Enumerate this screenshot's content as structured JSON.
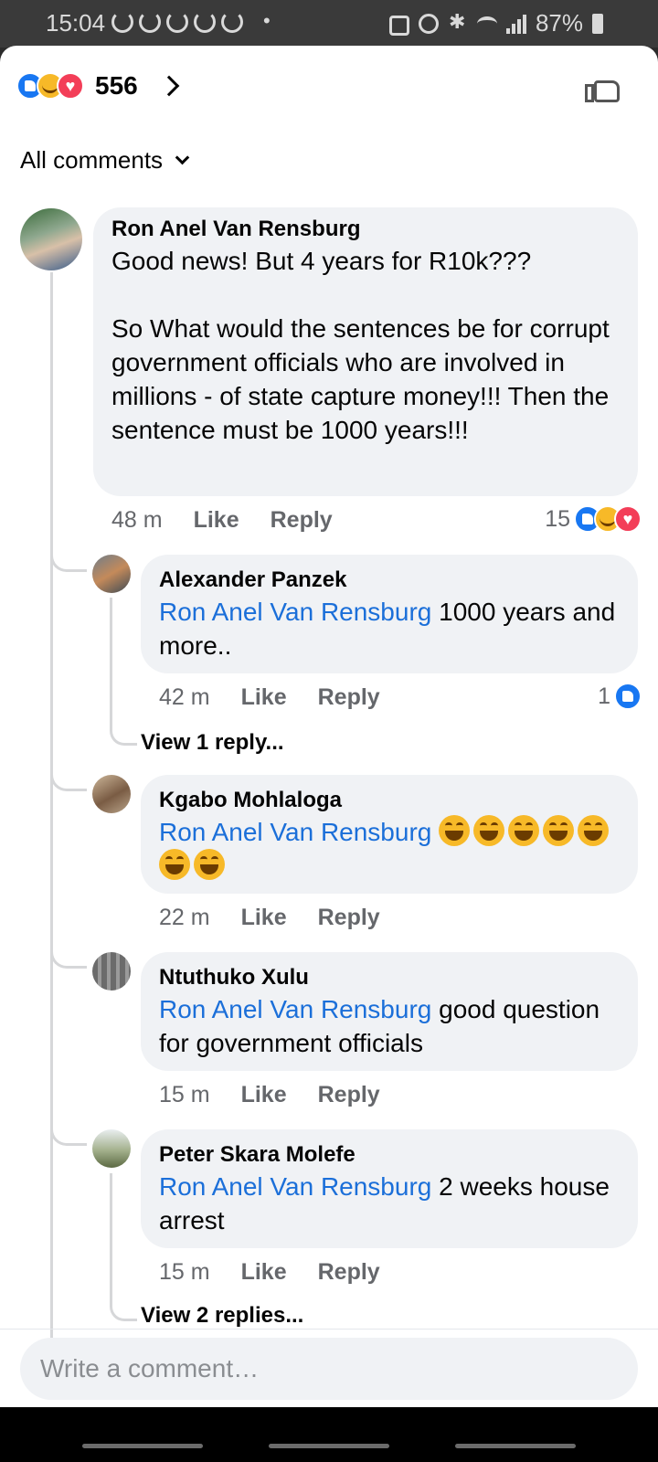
{
  "status_bar": {
    "time": "15:04",
    "dot": "•",
    "battery": "87%"
  },
  "header": {
    "reaction_count": "556",
    "reaction_icons": [
      "like-icon",
      "haha-icon",
      "love-icon"
    ]
  },
  "filter": {
    "label": "All comments"
  },
  "comments": [
    {
      "author": "Ron Anel Van Rensburg",
      "text": "Good news!  But 4 years for R10k???\n\nSo What would the sentences be for corrupt government officials who are involved in millions - of state capture money!!! Then the sentence must be 1000 years!!!",
      "time": "48 m",
      "like_label": "Like",
      "reply_label": "Reply",
      "reaction_count": "15"
    },
    {
      "author": "Alexander Panzek",
      "mention": "Ron Anel Van Rensburg",
      "text": " 1000 years and more..",
      "time": "42 m",
      "like_label": "Like",
      "reply_label": "Reply",
      "reaction_count": "1",
      "view_replies": "View 1 reply..."
    },
    {
      "author": "Kgabo Mohlaloga",
      "mention": "Ron Anel Van Rensburg",
      "emoji_count": 7,
      "emoji_name": "tears-of-joy-emoji",
      "time": "22 m",
      "like_label": "Like",
      "reply_label": "Reply"
    },
    {
      "author": "Ntuthuko Xulu",
      "mention": "Ron Anel Van Rensburg",
      "text": " good question for government officials",
      "time": "15 m",
      "like_label": "Like",
      "reply_label": "Reply"
    },
    {
      "author": "Peter Skara Molefe",
      "mention": "Ron Anel Van Rensburg",
      "text": " 2 weeks house arrest",
      "time": "15 m",
      "like_label": "Like",
      "reply_label": "Reply",
      "view_replies": "View 2 replies..."
    }
  ],
  "composer": {
    "placeholder": "Write a comment…"
  },
  "colors": {
    "like_blue": "#1877f2",
    "mention_blue": "#1b6fd9",
    "bubble_bg": "#f0f2f5",
    "meta_gray": "#65676b"
  }
}
